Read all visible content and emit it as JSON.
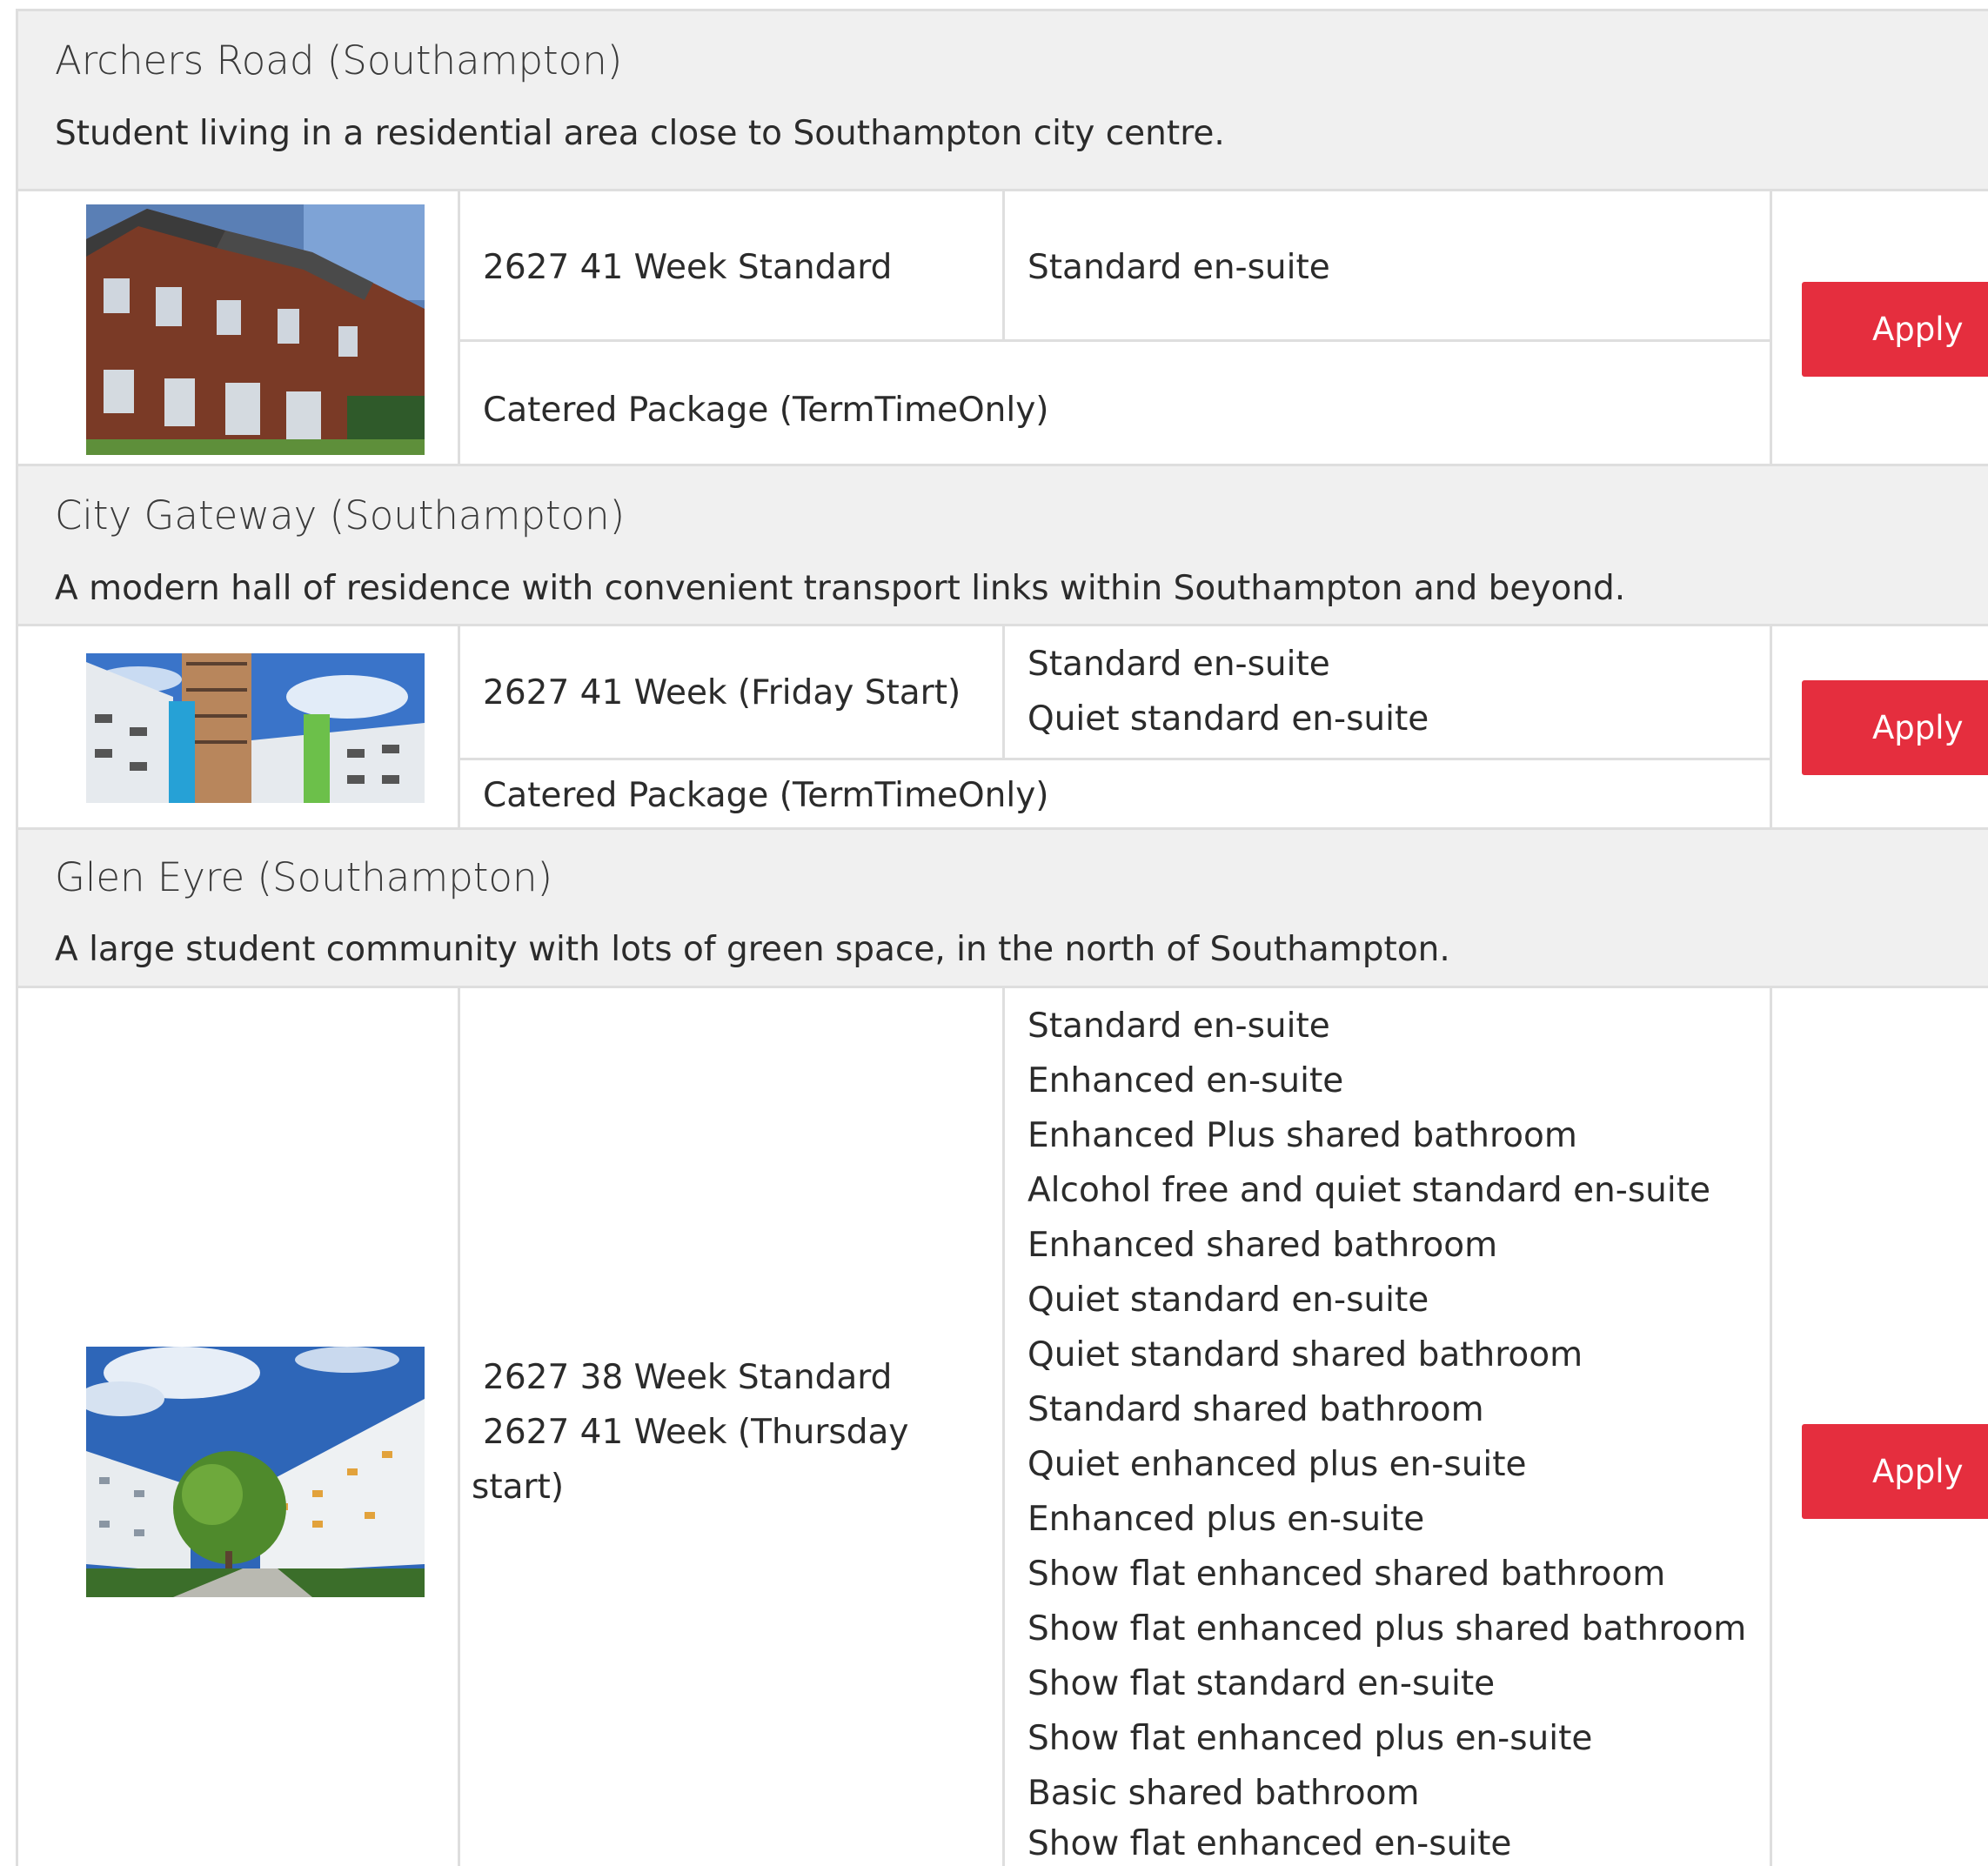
{
  "listings": [
    {
      "name": "Archers Road (Southampton)",
      "description": "Student living in a residential area close to Southampton city centre.",
      "contracts": [
        "2627 41 Week Standard"
      ],
      "room_types": [
        "Standard en-suite"
      ],
      "package": "Catered Package (TermTimeOnly)",
      "apply_label": "Apply"
    },
    {
      "name": "City Gateway (Southampton)",
      "description": "A modern hall of residence with convenient transport links within Southampton and beyond.",
      "contracts": [
        "2627 41 Week (Friday Start)"
      ],
      "room_types": [
        "Standard en-suite",
        "Quiet standard en-suite"
      ],
      "package": "Catered Package (TermTimeOnly)",
      "apply_label": "Apply"
    },
    {
      "name": "Glen Eyre (Southampton)",
      "description": "A large student community with lots of green space, in the north of Southampton.",
      "contracts": [
        "2627 38 Week Standard",
        "2627 41 Week (Thursday",
        "start)"
      ],
      "room_types": [
        "Standard en-suite",
        "Enhanced en-suite",
        "Enhanced Plus shared bathroom",
        "Alcohol free and quiet standard en-suite",
        "Enhanced shared bathroom",
        "Quiet standard en-suite",
        "Quiet standard shared bathroom",
        "Standard shared bathroom",
        "Quiet enhanced plus en-suite",
        "Enhanced plus en-suite",
        "Show flat enhanced shared bathroom",
        "Show flat enhanced plus shared bathroom",
        "Show flat standard en-suite",
        "Show flat enhanced plus en-suite",
        "Basic shared bathroom",
        "Show flat enhanced en-suite"
      ],
      "apply_label": "Apply"
    }
  ],
  "colors": {
    "apply_button": "#e52e3e",
    "header_background": "#f0f0f0",
    "border": "#dedede"
  }
}
